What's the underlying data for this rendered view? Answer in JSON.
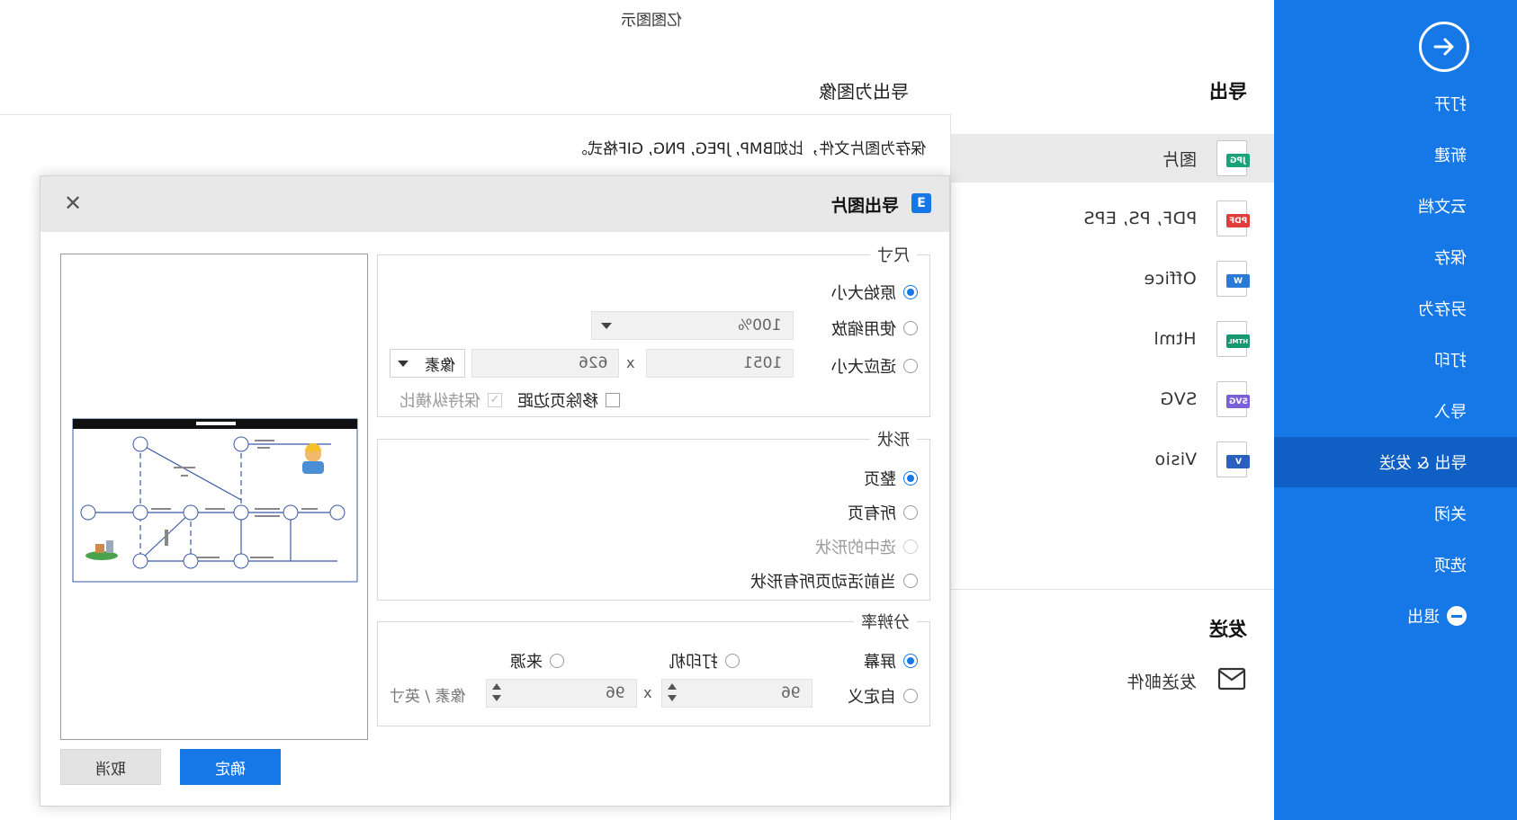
{
  "app_title": "亿图图示",
  "header": {
    "section_title": "导出为图像",
    "description": "保存为图片文件，比如BMP, JPEG, PNG, GIF格式。"
  },
  "sidebar": {
    "items": [
      {
        "label": "打开"
      },
      {
        "label": "新建"
      },
      {
        "label": "云文档"
      },
      {
        "label": "保存"
      },
      {
        "label": "另存为"
      },
      {
        "label": "打印"
      },
      {
        "label": "导入"
      },
      {
        "label": "导出 & 发送"
      },
      {
        "label": "关闭"
      },
      {
        "label": "选项"
      },
      {
        "label": "退出"
      }
    ],
    "active_index": 7,
    "accent_color": "#1677e6"
  },
  "export_panel": {
    "title": "导出",
    "items": [
      {
        "label": "图片",
        "tag": "JPG",
        "color": "#1aa37a"
      },
      {
        "label": "PDF, PS, EPS",
        "tag": "PDF",
        "color": "#e03c3c"
      },
      {
        "label": "Office",
        "tag": "W",
        "color": "#2b7bd6"
      },
      {
        "label": "Html",
        "tag": "HTML",
        "color": "#13986f"
      },
      {
        "label": "SVG",
        "tag": "SVG",
        "color": "#7b5fd6"
      },
      {
        "label": "Visio",
        "tag": "V",
        "color": "#2b5fbf"
      }
    ],
    "send_title": "发送",
    "send_items": [
      {
        "label": "发送邮件"
      }
    ]
  },
  "dialog": {
    "title": "导出图片",
    "close_icon": "close-icon",
    "size_group": {
      "legend": "尺寸",
      "original_size": "原始大小",
      "use_scale": "使用缩放",
      "fit_size": "适应大小",
      "scale_value": "100%",
      "width_value": "1051",
      "height_value": "626",
      "x": "x",
      "unit_value": "像素",
      "remove_margin": "移除页边距",
      "keep_ratio": "保持纵横比"
    },
    "shape_group": {
      "legend": "形状",
      "whole_page": "整页",
      "all_pages": "所有页",
      "selected_shapes": "选中的形状",
      "current_page_shapes": "当前活动页所有形状"
    },
    "resolution_group": {
      "legend": "分辨率",
      "screen": "屏幕",
      "printer": "打印机",
      "source": "来源",
      "custom": "自定义",
      "dpi_x": "96",
      "dpi_y": "96",
      "x": "x",
      "unit": "像素 / 英寸"
    },
    "ok_label": "确定",
    "cancel_label": "取消"
  }
}
